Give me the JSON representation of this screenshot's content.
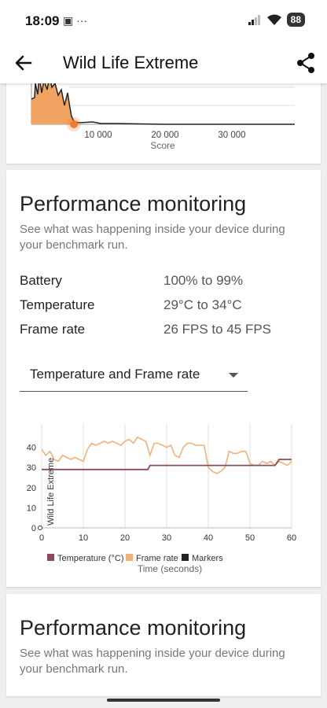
{
  "status": {
    "time": "18:09",
    "extra": "▣ ···",
    "battery": "88"
  },
  "app_bar": {
    "title": "Wild Life Extreme"
  },
  "score_chart": {
    "type": "area",
    "x_ticks": [
      "10 000",
      "20 000",
      "30 000"
    ],
    "xlabel": "Score"
  },
  "perf": {
    "title": "Performance monitoring",
    "subtitle": "See what was happening inside your device during your benchmark run.",
    "metrics": [
      {
        "label": "Battery",
        "value": "100% to 99%"
      },
      {
        "label": "Temperature",
        "value": "29°C to 34°C"
      },
      {
        "label": "Frame rate",
        "value": "26 FPS to 45 FPS"
      }
    ],
    "dropdown_value": "Temperature and Frame rate"
  },
  "perf2": {
    "title": "Performance monitoring",
    "subtitle": "See what was happening inside your device during your benchmark run."
  },
  "chart_data": {
    "type": "line",
    "x_ticks": [
      "0",
      "10",
      "20",
      "30",
      "40",
      "50",
      "60"
    ],
    "y_ticks": [
      "0",
      "10",
      "20",
      "30",
      "40"
    ],
    "xlabel": "Time (seconds)",
    "marker_label": "Wild Life Extreme",
    "xlim": [
      0,
      60
    ],
    "ylim": [
      0,
      50
    ],
    "legend_position": "bottom",
    "series": [
      {
        "name": "Temperature (°C)",
        "color": "#8a4a5a",
        "x": [
          0,
          25.5,
          26,
          41,
          56,
          57,
          60
        ],
        "y": [
          29,
          29,
          31,
          31,
          31,
          34,
          34
        ]
      },
      {
        "name": "Frame rate",
        "color": "#f0b27a",
        "x": [
          0,
          1,
          2,
          3,
          4,
          5,
          6,
          7,
          8,
          9,
          10,
          11,
          12,
          13,
          14,
          15,
          16,
          17,
          18,
          19,
          20,
          21,
          22,
          23,
          24,
          25,
          26,
          27,
          28,
          29,
          30,
          31,
          32,
          33,
          34,
          35,
          36,
          37,
          38,
          39,
          40,
          41,
          42,
          43,
          44,
          45,
          46,
          47,
          48,
          49,
          50,
          51,
          52,
          53,
          54,
          55,
          56,
          57,
          58,
          59,
          60
        ],
        "y": [
          39,
          36,
          38,
          34,
          33,
          36,
          35,
          34,
          35,
          34,
          33,
          39,
          42,
          41,
          42,
          43,
          42,
          43,
          42,
          41,
          43,
          44,
          42,
          45,
          44,
          43,
          36,
          42,
          42,
          41,
          40,
          41,
          36,
          35,
          40,
          42,
          42,
          41,
          41,
          41,
          30,
          28,
          27,
          28,
          30,
          38,
          37,
          37,
          38,
          38,
          32,
          31,
          31,
          33,
          32,
          33,
          31,
          33,
          32,
          31,
          33
        ]
      },
      {
        "name": "Markers",
        "color": "#222222"
      }
    ]
  }
}
